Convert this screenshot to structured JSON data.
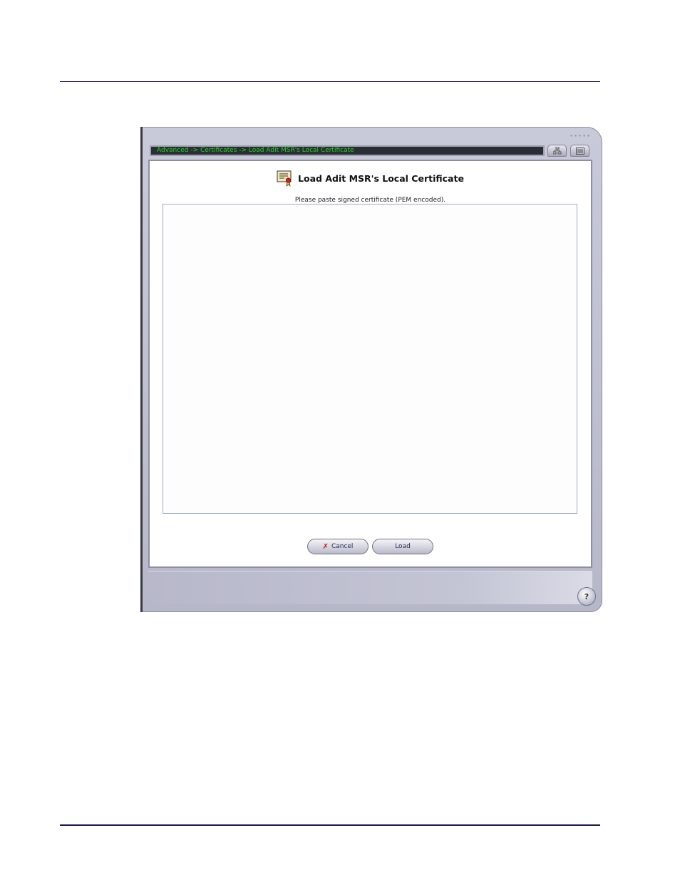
{
  "breadcrumb": "Advanced -> Certificates -> Load Adit MSR's Local Certificate",
  "dialog": {
    "title": "Load Adit MSR's Local Certificate",
    "instruction": "Please paste signed certificate (PEM encoded).",
    "certificate_value": ""
  },
  "buttons": {
    "cancel": "Cancel",
    "load": "Load",
    "help": "?"
  },
  "icons": {
    "certificate": "certificate-icon",
    "tree_view": "tree-view-icon",
    "list_view": "list-view-icon",
    "cancel": "x-icon",
    "help": "help-icon"
  },
  "colors": {
    "breadcrumb_text": "#22d922",
    "breadcrumb_bg": "#2a2d33",
    "cancel_x": "#cc1111"
  }
}
